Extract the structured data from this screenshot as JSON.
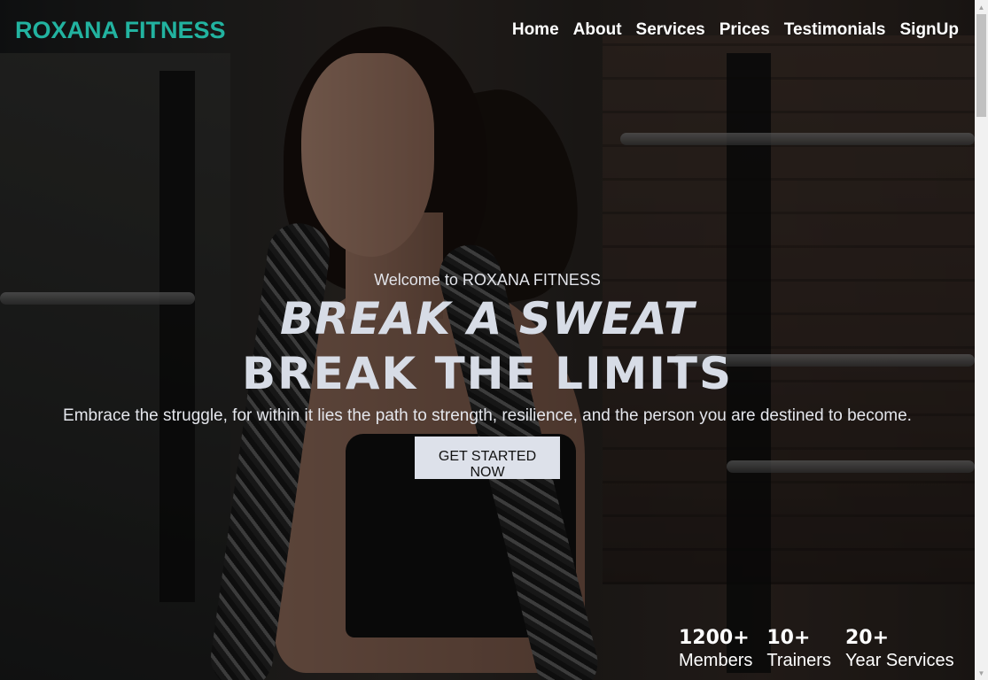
{
  "brand": {
    "name": "ROXANA FITNESS",
    "color": "#22b3a0"
  },
  "nav": {
    "items": [
      "Home",
      "About",
      "Services",
      "Prices",
      "Testimonials",
      "SignUp"
    ]
  },
  "hero": {
    "welcome": "Welcome to ROXANA FITNESS",
    "headline_line1": "BREAK A SWEAT",
    "headline_line2": "BREAK THE LIMITS",
    "tagline": "Embrace the struggle, for within it lies the path to strength, resilience, and the person you are destined to become.",
    "cta_label": "GET STARTED NOW"
  },
  "stats": [
    {
      "value": "1200+",
      "label": "Members"
    },
    {
      "value": "10+",
      "label": "Trainers"
    },
    {
      "value": "20+",
      "label": "Year Services"
    }
  ],
  "colors": {
    "headline": "#d7dce6",
    "cta_bg": "#dde1ea",
    "nav_text": "#ffffff"
  }
}
